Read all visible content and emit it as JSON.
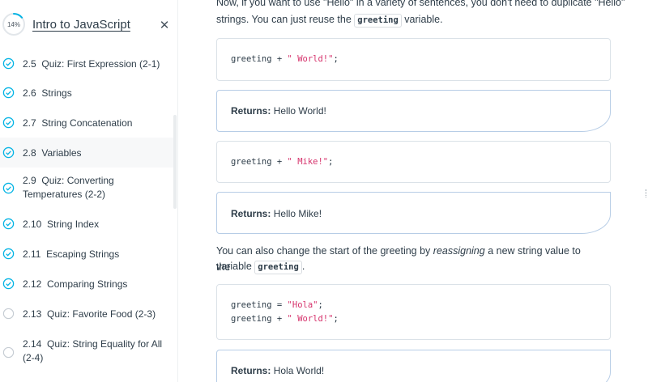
{
  "sidebar": {
    "progress_label": "14%",
    "progress_value": 0.14,
    "course_title": "Intro to JavaScript",
    "close_icon": "close-icon",
    "accent_color": "#02b3e4",
    "items": [
      {
        "num": "2.5",
        "label": "Quiz: First Expression (2-1)",
        "completed": true
      },
      {
        "num": "2.6",
        "label": "Strings",
        "completed": true
      },
      {
        "num": "2.7",
        "label": "String Concatenation",
        "completed": true
      },
      {
        "num": "2.8",
        "label": "Variables",
        "completed": true,
        "active": true
      },
      {
        "num": "2.9",
        "label": "Quiz: Converting Temperatures (2-2)",
        "completed": true
      },
      {
        "num": "2.10",
        "label": "String Index",
        "completed": true
      },
      {
        "num": "2.11",
        "label": "Escaping Strings",
        "completed": true
      },
      {
        "num": "2.12",
        "label": "Comparing Strings",
        "completed": true
      },
      {
        "num": "2.13",
        "label": "Quiz: Favorite Food (2-3)",
        "completed": false
      },
      {
        "num": "2.14",
        "label": "Quiz: String Equality for All (2-4)",
        "completed": false
      }
    ]
  },
  "main": {
    "intro": {
      "line1": "Now, if you want to use \"Hello\" in a variety of sentences, you don't need to duplicate \"Hello\"",
      "line2_before": "strings. You can just reuse the ",
      "line2_code": "greeting",
      "line2_after": " variable."
    },
    "code1": {
      "var": "greeting",
      "op": " + ",
      "str": "\" World!\"",
      "end": ";"
    },
    "result1": {
      "label": "Returns:",
      "value": "Hello World!"
    },
    "code2": {
      "var": "greeting",
      "op": " + ",
      "str": "\" Mike!\"",
      "end": ";"
    },
    "result2": {
      "label": "Returns:",
      "value": "Hello Mike!"
    },
    "reassign": {
      "before": "You can also change the start of the greeting by ",
      "em": "reassigning",
      "after": " a new string value to the",
      "line2_before": "variable ",
      "line2_code": "greeting",
      "line2_after": "."
    },
    "code3": {
      "l1_var": "greeting",
      "l1_op": " = ",
      "l1_str": "\"Hola\"",
      "l1_end": ";",
      "l2_var": "greeting",
      "l2_op": " + ",
      "l2_str": "\" World!\"",
      "l2_end": ";"
    },
    "result3": {
      "label": "Returns:",
      "value": "Hola World!"
    },
    "string_color": "#d6336c"
  }
}
